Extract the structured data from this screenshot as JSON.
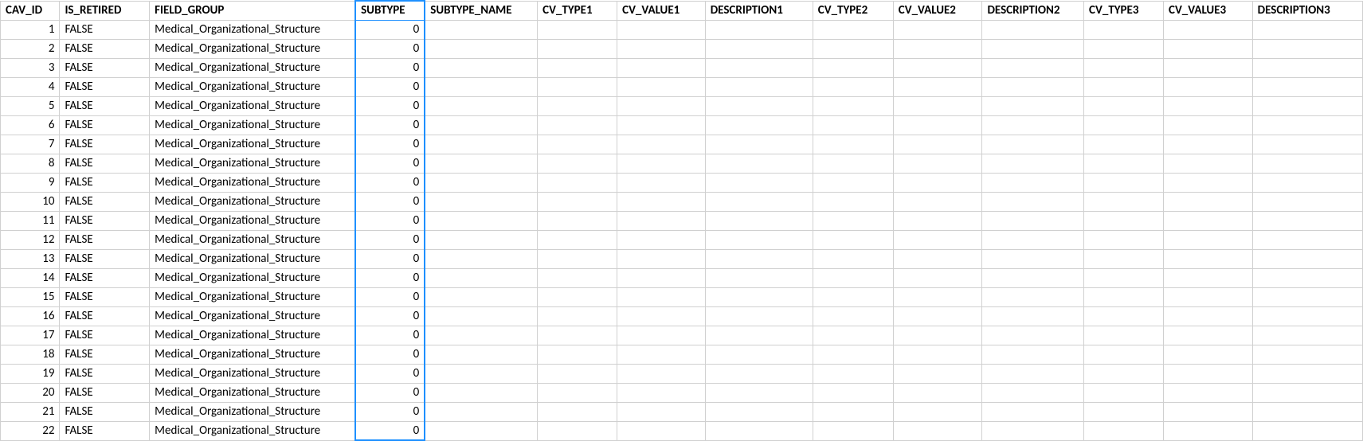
{
  "table": {
    "highlight_column_index": 3,
    "columns": [
      {
        "key": "CAV_ID",
        "label": "CAV_ID",
        "align": "num"
      },
      {
        "key": "IS_RETIRED",
        "label": "IS_RETIRED",
        "align": "txt"
      },
      {
        "key": "FIELD_GROUP",
        "label": "FIELD_GROUP",
        "align": "txt"
      },
      {
        "key": "SUBTYPE",
        "label": "SUBTYPE",
        "align": "num"
      },
      {
        "key": "SUBTYPE_NAME",
        "label": "SUBTYPE_NAME",
        "align": "txt"
      },
      {
        "key": "CV_TYPE1",
        "label": "CV_TYPE1",
        "align": "txt"
      },
      {
        "key": "CV_VALUE1",
        "label": "CV_VALUE1",
        "align": "txt"
      },
      {
        "key": "DESCRIPTION1",
        "label": "DESCRIPTION1",
        "align": "txt"
      },
      {
        "key": "CV_TYPE2",
        "label": "CV_TYPE2",
        "align": "txt"
      },
      {
        "key": "CV_VALUE2",
        "label": "CV_VALUE2",
        "align": "txt"
      },
      {
        "key": "DESCRIPTION2",
        "label": "DESCRIPTION2",
        "align": "txt"
      },
      {
        "key": "CV_TYPE3",
        "label": "CV_TYPE3",
        "align": "txt"
      },
      {
        "key": "CV_VALUE3",
        "label": "CV_VALUE3",
        "align": "txt"
      },
      {
        "key": "DESCRIPTION3",
        "label": "DESCRIPTION3",
        "align": "txt"
      }
    ],
    "rows": [
      {
        "CAV_ID": "1",
        "IS_RETIRED": "FALSE",
        "FIELD_GROUP": "Medical_Organizational_Structure",
        "SUBTYPE": "0",
        "SUBTYPE_NAME": "",
        "CV_TYPE1": "",
        "CV_VALUE1": "",
        "DESCRIPTION1": "",
        "CV_TYPE2": "",
        "CV_VALUE2": "",
        "DESCRIPTION2": "",
        "CV_TYPE3": "",
        "CV_VALUE3": "",
        "DESCRIPTION3": ""
      },
      {
        "CAV_ID": "2",
        "IS_RETIRED": "FALSE",
        "FIELD_GROUP": "Medical_Organizational_Structure",
        "SUBTYPE": "0",
        "SUBTYPE_NAME": "",
        "CV_TYPE1": "",
        "CV_VALUE1": "",
        "DESCRIPTION1": "",
        "CV_TYPE2": "",
        "CV_VALUE2": "",
        "DESCRIPTION2": "",
        "CV_TYPE3": "",
        "CV_VALUE3": "",
        "DESCRIPTION3": ""
      },
      {
        "CAV_ID": "3",
        "IS_RETIRED": "FALSE",
        "FIELD_GROUP": "Medical_Organizational_Structure",
        "SUBTYPE": "0",
        "SUBTYPE_NAME": "",
        "CV_TYPE1": "",
        "CV_VALUE1": "",
        "DESCRIPTION1": "",
        "CV_TYPE2": "",
        "CV_VALUE2": "",
        "DESCRIPTION2": "",
        "CV_TYPE3": "",
        "CV_VALUE3": "",
        "DESCRIPTION3": ""
      },
      {
        "CAV_ID": "4",
        "IS_RETIRED": "FALSE",
        "FIELD_GROUP": "Medical_Organizational_Structure",
        "SUBTYPE": "0",
        "SUBTYPE_NAME": "",
        "CV_TYPE1": "",
        "CV_VALUE1": "",
        "DESCRIPTION1": "",
        "CV_TYPE2": "",
        "CV_VALUE2": "",
        "DESCRIPTION2": "",
        "CV_TYPE3": "",
        "CV_VALUE3": "",
        "DESCRIPTION3": ""
      },
      {
        "CAV_ID": "5",
        "IS_RETIRED": "FALSE",
        "FIELD_GROUP": "Medical_Organizational_Structure",
        "SUBTYPE": "0",
        "SUBTYPE_NAME": "",
        "CV_TYPE1": "",
        "CV_VALUE1": "",
        "DESCRIPTION1": "",
        "CV_TYPE2": "",
        "CV_VALUE2": "",
        "DESCRIPTION2": "",
        "CV_TYPE3": "",
        "CV_VALUE3": "",
        "DESCRIPTION3": ""
      },
      {
        "CAV_ID": "6",
        "IS_RETIRED": "FALSE",
        "FIELD_GROUP": "Medical_Organizational_Structure",
        "SUBTYPE": "0",
        "SUBTYPE_NAME": "",
        "CV_TYPE1": "",
        "CV_VALUE1": "",
        "DESCRIPTION1": "",
        "CV_TYPE2": "",
        "CV_VALUE2": "",
        "DESCRIPTION2": "",
        "CV_TYPE3": "",
        "CV_VALUE3": "",
        "DESCRIPTION3": ""
      },
      {
        "CAV_ID": "7",
        "IS_RETIRED": "FALSE",
        "FIELD_GROUP": "Medical_Organizational_Structure",
        "SUBTYPE": "0",
        "SUBTYPE_NAME": "",
        "CV_TYPE1": "",
        "CV_VALUE1": "",
        "DESCRIPTION1": "",
        "CV_TYPE2": "",
        "CV_VALUE2": "",
        "DESCRIPTION2": "",
        "CV_TYPE3": "",
        "CV_VALUE3": "",
        "DESCRIPTION3": ""
      },
      {
        "CAV_ID": "8",
        "IS_RETIRED": "FALSE",
        "FIELD_GROUP": "Medical_Organizational_Structure",
        "SUBTYPE": "0",
        "SUBTYPE_NAME": "",
        "CV_TYPE1": "",
        "CV_VALUE1": "",
        "DESCRIPTION1": "",
        "CV_TYPE2": "",
        "CV_VALUE2": "",
        "DESCRIPTION2": "",
        "CV_TYPE3": "",
        "CV_VALUE3": "",
        "DESCRIPTION3": ""
      },
      {
        "CAV_ID": "9",
        "IS_RETIRED": "FALSE",
        "FIELD_GROUP": "Medical_Organizational_Structure",
        "SUBTYPE": "0",
        "SUBTYPE_NAME": "",
        "CV_TYPE1": "",
        "CV_VALUE1": "",
        "DESCRIPTION1": "",
        "CV_TYPE2": "",
        "CV_VALUE2": "",
        "DESCRIPTION2": "",
        "CV_TYPE3": "",
        "CV_VALUE3": "",
        "DESCRIPTION3": ""
      },
      {
        "CAV_ID": "10",
        "IS_RETIRED": "FALSE",
        "FIELD_GROUP": "Medical_Organizational_Structure",
        "SUBTYPE": "0",
        "SUBTYPE_NAME": "",
        "CV_TYPE1": "",
        "CV_VALUE1": "",
        "DESCRIPTION1": "",
        "CV_TYPE2": "",
        "CV_VALUE2": "",
        "DESCRIPTION2": "",
        "CV_TYPE3": "",
        "CV_VALUE3": "",
        "DESCRIPTION3": ""
      },
      {
        "CAV_ID": "11",
        "IS_RETIRED": "FALSE",
        "FIELD_GROUP": "Medical_Organizational_Structure",
        "SUBTYPE": "0",
        "SUBTYPE_NAME": "",
        "CV_TYPE1": "",
        "CV_VALUE1": "",
        "DESCRIPTION1": "",
        "CV_TYPE2": "",
        "CV_VALUE2": "",
        "DESCRIPTION2": "",
        "CV_TYPE3": "",
        "CV_VALUE3": "",
        "DESCRIPTION3": ""
      },
      {
        "CAV_ID": "12",
        "IS_RETIRED": "FALSE",
        "FIELD_GROUP": "Medical_Organizational_Structure",
        "SUBTYPE": "0",
        "SUBTYPE_NAME": "",
        "CV_TYPE1": "",
        "CV_VALUE1": "",
        "DESCRIPTION1": "",
        "CV_TYPE2": "",
        "CV_VALUE2": "",
        "DESCRIPTION2": "",
        "CV_TYPE3": "",
        "CV_VALUE3": "",
        "DESCRIPTION3": ""
      },
      {
        "CAV_ID": "13",
        "IS_RETIRED": "FALSE",
        "FIELD_GROUP": "Medical_Organizational_Structure",
        "SUBTYPE": "0",
        "SUBTYPE_NAME": "",
        "CV_TYPE1": "",
        "CV_VALUE1": "",
        "DESCRIPTION1": "",
        "CV_TYPE2": "",
        "CV_VALUE2": "",
        "DESCRIPTION2": "",
        "CV_TYPE3": "",
        "CV_VALUE3": "",
        "DESCRIPTION3": ""
      },
      {
        "CAV_ID": "14",
        "IS_RETIRED": "FALSE",
        "FIELD_GROUP": "Medical_Organizational_Structure",
        "SUBTYPE": "0",
        "SUBTYPE_NAME": "",
        "CV_TYPE1": "",
        "CV_VALUE1": "",
        "DESCRIPTION1": "",
        "CV_TYPE2": "",
        "CV_VALUE2": "",
        "DESCRIPTION2": "",
        "CV_TYPE3": "",
        "CV_VALUE3": "",
        "DESCRIPTION3": ""
      },
      {
        "CAV_ID": "15",
        "IS_RETIRED": "FALSE",
        "FIELD_GROUP": "Medical_Organizational_Structure",
        "SUBTYPE": "0",
        "SUBTYPE_NAME": "",
        "CV_TYPE1": "",
        "CV_VALUE1": "",
        "DESCRIPTION1": "",
        "CV_TYPE2": "",
        "CV_VALUE2": "",
        "DESCRIPTION2": "",
        "CV_TYPE3": "",
        "CV_VALUE3": "",
        "DESCRIPTION3": ""
      },
      {
        "CAV_ID": "16",
        "IS_RETIRED": "FALSE",
        "FIELD_GROUP": "Medical_Organizational_Structure",
        "SUBTYPE": "0",
        "SUBTYPE_NAME": "",
        "CV_TYPE1": "",
        "CV_VALUE1": "",
        "DESCRIPTION1": "",
        "CV_TYPE2": "",
        "CV_VALUE2": "",
        "DESCRIPTION2": "",
        "CV_TYPE3": "",
        "CV_VALUE3": "",
        "DESCRIPTION3": ""
      },
      {
        "CAV_ID": "17",
        "IS_RETIRED": "FALSE",
        "FIELD_GROUP": "Medical_Organizational_Structure",
        "SUBTYPE": "0",
        "SUBTYPE_NAME": "",
        "CV_TYPE1": "",
        "CV_VALUE1": "",
        "DESCRIPTION1": "",
        "CV_TYPE2": "",
        "CV_VALUE2": "",
        "DESCRIPTION2": "",
        "CV_TYPE3": "",
        "CV_VALUE3": "",
        "DESCRIPTION3": ""
      },
      {
        "CAV_ID": "18",
        "IS_RETIRED": "FALSE",
        "FIELD_GROUP": "Medical_Organizational_Structure",
        "SUBTYPE": "0",
        "SUBTYPE_NAME": "",
        "CV_TYPE1": "",
        "CV_VALUE1": "",
        "DESCRIPTION1": "",
        "CV_TYPE2": "",
        "CV_VALUE2": "",
        "DESCRIPTION2": "",
        "CV_TYPE3": "",
        "CV_VALUE3": "",
        "DESCRIPTION3": ""
      },
      {
        "CAV_ID": "19",
        "IS_RETIRED": "FALSE",
        "FIELD_GROUP": "Medical_Organizational_Structure",
        "SUBTYPE": "0",
        "SUBTYPE_NAME": "",
        "CV_TYPE1": "",
        "CV_VALUE1": "",
        "DESCRIPTION1": "",
        "CV_TYPE2": "",
        "CV_VALUE2": "",
        "DESCRIPTION2": "",
        "CV_TYPE3": "",
        "CV_VALUE3": "",
        "DESCRIPTION3": ""
      },
      {
        "CAV_ID": "20",
        "IS_RETIRED": "FALSE",
        "FIELD_GROUP": "Medical_Organizational_Structure",
        "SUBTYPE": "0",
        "SUBTYPE_NAME": "",
        "CV_TYPE1": "",
        "CV_VALUE1": "",
        "DESCRIPTION1": "",
        "CV_TYPE2": "",
        "CV_VALUE2": "",
        "DESCRIPTION2": "",
        "CV_TYPE3": "",
        "CV_VALUE3": "",
        "DESCRIPTION3": ""
      },
      {
        "CAV_ID": "21",
        "IS_RETIRED": "FALSE",
        "FIELD_GROUP": "Medical_Organizational_Structure",
        "SUBTYPE": "0",
        "SUBTYPE_NAME": "",
        "CV_TYPE1": "",
        "CV_VALUE1": "",
        "DESCRIPTION1": "",
        "CV_TYPE2": "",
        "CV_VALUE2": "",
        "DESCRIPTION2": "",
        "CV_TYPE3": "",
        "CV_VALUE3": "",
        "DESCRIPTION3": ""
      },
      {
        "CAV_ID": "22",
        "IS_RETIRED": "FALSE",
        "FIELD_GROUP": "Medical_Organizational_Structure",
        "SUBTYPE": "0",
        "SUBTYPE_NAME": "",
        "CV_TYPE1": "",
        "CV_VALUE1": "",
        "DESCRIPTION1": "",
        "CV_TYPE2": "",
        "CV_VALUE2": "",
        "DESCRIPTION2": "",
        "CV_TYPE3": "",
        "CV_VALUE3": "",
        "DESCRIPTION3": ""
      }
    ]
  }
}
